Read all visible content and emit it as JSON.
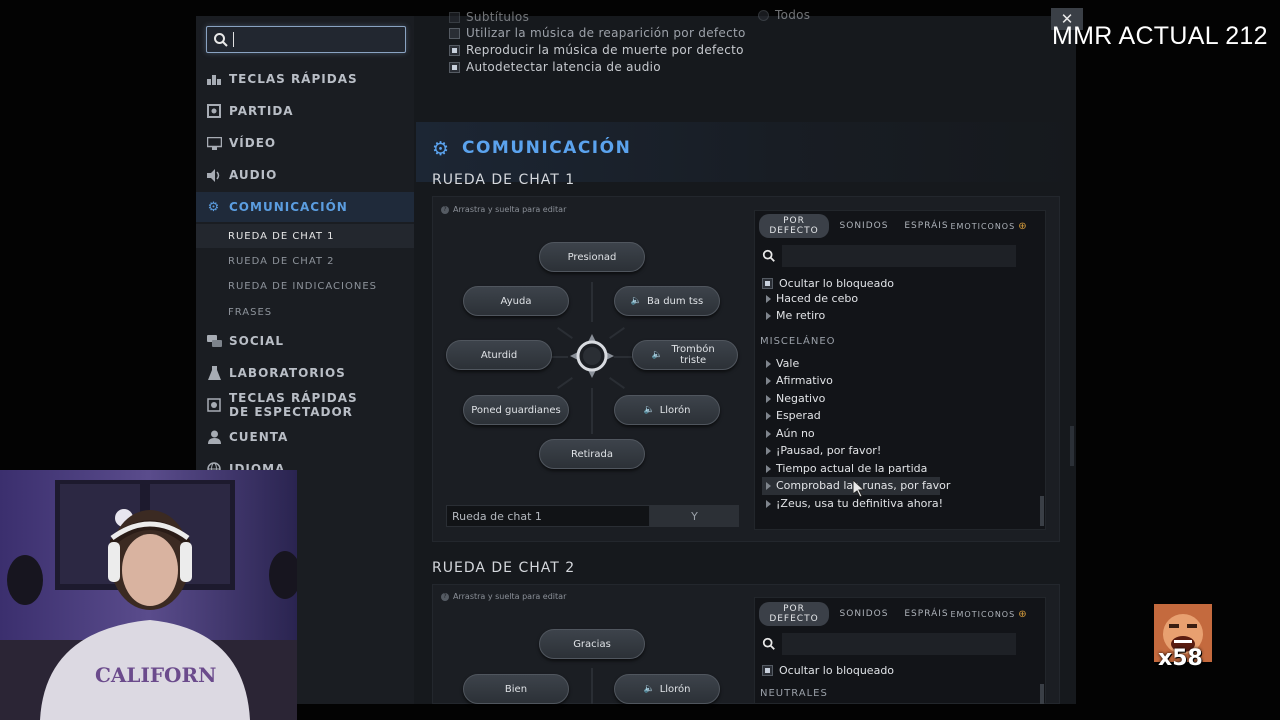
{
  "sidebar": {
    "search_placeholder": "",
    "items": [
      {
        "label": "TECLAS RÁPIDAS",
        "icon": "hotkeys-icon"
      },
      {
        "label": "PARTIDA",
        "icon": "game-icon"
      },
      {
        "label": "VÍDEO",
        "icon": "monitor-icon"
      },
      {
        "label": "AUDIO",
        "icon": "speaker-icon"
      },
      {
        "label": "COMUNICACIÓN",
        "icon": "gear-icon"
      },
      {
        "label": "SOCIAL",
        "icon": "chat-bubbles-icon"
      },
      {
        "label": "LABORATORIOS",
        "icon": "flask-icon"
      },
      {
        "label": "TECLAS RÁPIDAS DE ESPECTADOR",
        "icon": "spectator-icon"
      },
      {
        "label": "CUENTA",
        "icon": "person-icon"
      },
      {
        "label": "IDIOMA",
        "icon": "globe-icon"
      }
    ],
    "subitems": [
      "RUEDA DE CHAT 1",
      "RUEDA DE CHAT 2",
      "RUEDA DE INDICACIONES",
      "FRASES"
    ]
  },
  "audio_options": {
    "subtitles": "Subtítulos",
    "respawn_music": "Utilizar la música de reaparición por defecto",
    "death_music": "Reproducir la música de muerte por defecto",
    "auto_latency": "Autodetectar latencia de audio",
    "top_right": "Todos"
  },
  "communication": {
    "title": "COMUNICACIÓN",
    "wheel1": {
      "title": "RUEDA DE CHAT 1",
      "hint": "Arrastra y suelta para editar",
      "slots": {
        "top": "Presionad",
        "upper_left": "Ayuda",
        "upper_right": "Ba dum tss",
        "left": "Aturdid",
        "right": "Trombón triste",
        "lower_left": "Poned guardianes",
        "lower_right": "Llorón",
        "bottom": "Retirada"
      },
      "name_input": "Rueda de chat 1",
      "hotkey": "Y"
    },
    "wheel2": {
      "title": "RUEDA DE CHAT 2",
      "hint": "Arrastra y suelta para editar",
      "slots": {
        "top": "Gracias",
        "upper_left": "Bien",
        "upper_right": "Llorón"
      }
    }
  },
  "phrase_panel": {
    "tabs": [
      "POR DEFECTO",
      "SONIDOS",
      "ESPRÁIS",
      "EMOTICONOS"
    ],
    "hide_blocked": "Ocultar lo bloqueado",
    "items_before": [
      "Haced de cebo",
      "Me retiro"
    ],
    "category": "MISCELÁNEO",
    "items": [
      "Vale",
      "Afirmativo",
      "Negativo",
      "Esperad",
      "Aún no",
      "¡Pausad, por favor!",
      "Tiempo actual de la partida",
      "Comprobad las runas, por favor",
      "¡Zeus, usa tu definitiva ahora!"
    ],
    "highlighted": "Comprobad las runas, por favor"
  },
  "phrase_panel2": {
    "tabs": [
      "POR DEFECTO",
      "SONIDOS",
      "ESPRÁIS",
      "EMOTICONOS"
    ],
    "hide_blocked": "Ocultar lo bloqueado",
    "category": "NEUTRALES"
  },
  "overlay": {
    "mmr_text": "MMR ACTUAL 212",
    "close": "✕",
    "emote_multiplier": "x58"
  },
  "colors": {
    "accent": "#5ba3ee",
    "window_bg": "#16191d",
    "sidebar_bg": "#1a1d22"
  }
}
